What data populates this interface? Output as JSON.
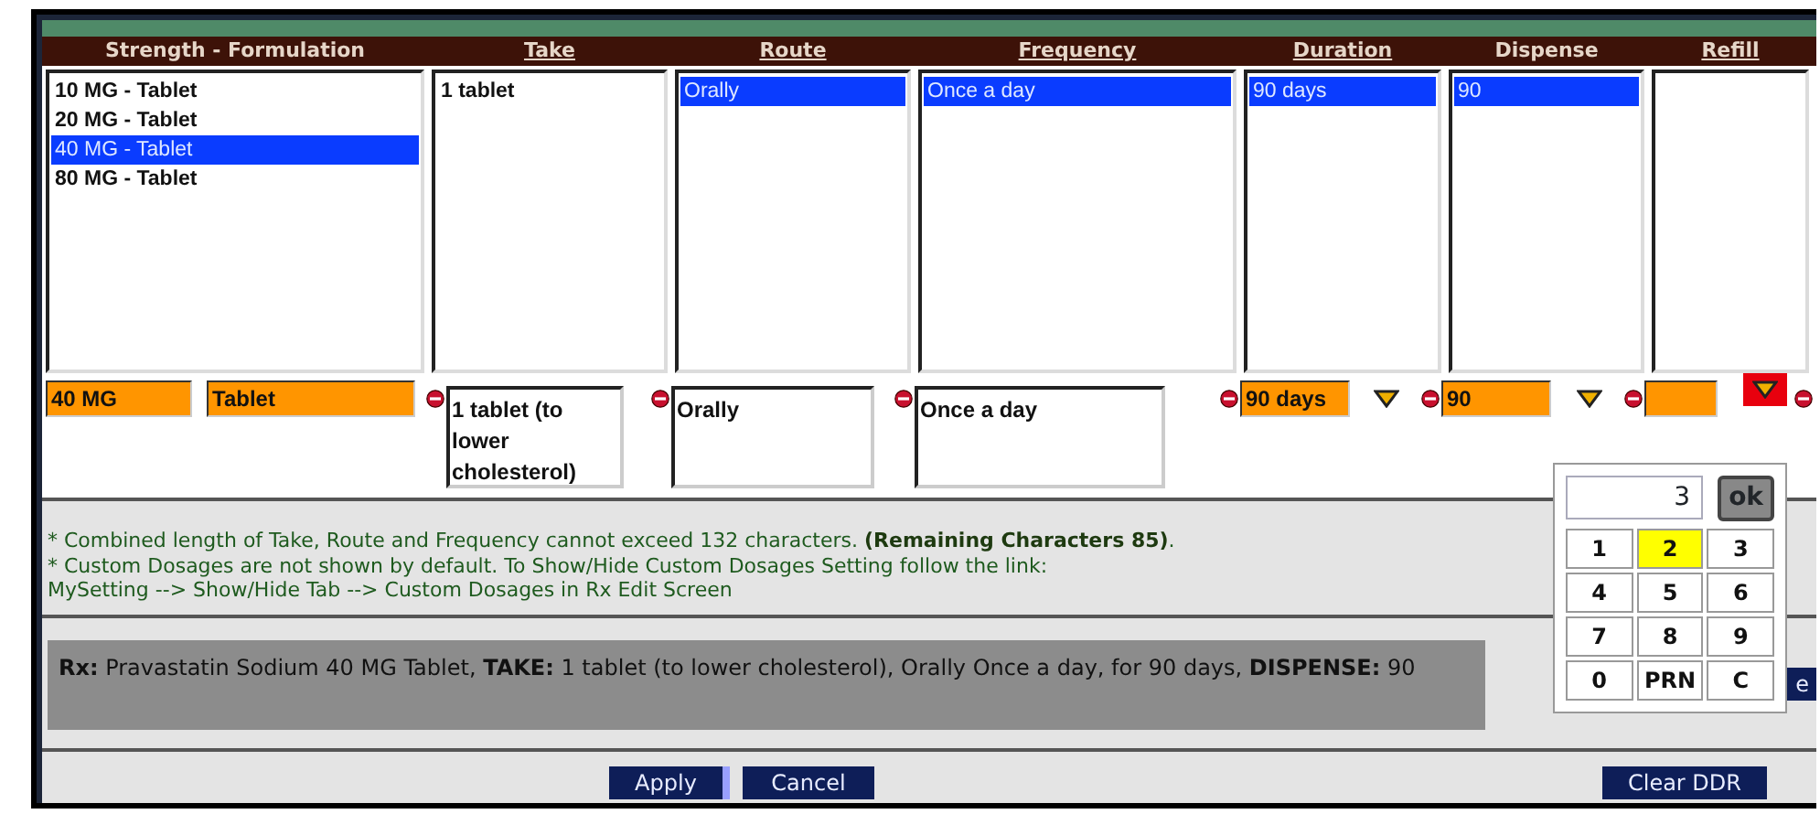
{
  "columns": [
    {
      "label": "Strength - Formulation",
      "underlined": false,
      "items": [
        {
          "text": "10 MG - Tablet",
          "selected": false
        },
        {
          "text": "20 MG - Tablet",
          "selected": false
        },
        {
          "text": "40 MG - Tablet",
          "selected": true
        },
        {
          "text": "80 MG - Tablet",
          "selected": false
        }
      ]
    },
    {
      "label": "Take",
      "underlined": true,
      "items": [
        {
          "text": "1 tablet",
          "selected": false
        }
      ]
    },
    {
      "label": "Route",
      "underlined": true,
      "items": [
        {
          "text": "Orally",
          "selected": true
        }
      ]
    },
    {
      "label": "Frequency",
      "underlined": true,
      "items": [
        {
          "text": "Once a day",
          "selected": true
        }
      ]
    },
    {
      "label": "Duration",
      "underlined": true,
      "items": [
        {
          "text": "90 days",
          "selected": true
        }
      ]
    },
    {
      "label": "Dispense",
      "underlined": false,
      "items": [
        {
          "text": "90",
          "selected": true
        }
      ]
    },
    {
      "label": "Refill",
      "underlined": true
    }
  ],
  "edit_row": [
    {
      "fields": [
        {
          "kind": "orange",
          "value": "40 MG"
        },
        {
          "kind": "orange",
          "value": "Tablet"
        }
      ]
    },
    {
      "fields": [
        {
          "kind": "textarea",
          "value": "1 tablet (to lower cholesterol)"
        }
      ],
      "remove": true
    },
    {
      "fields": [
        {
          "kind": "textarea",
          "value": "Orally"
        }
      ],
      "remove": true
    },
    {
      "fields": [
        {
          "kind": "textarea",
          "value": "Once a day"
        }
      ],
      "remove": true
    },
    {
      "fields": [
        {
          "kind": "orange",
          "value": "90 days"
        }
      ],
      "dropdown": true,
      "highlighted": false,
      "remove": true
    },
    {
      "fields": [
        {
          "kind": "orange",
          "value": "90"
        }
      ],
      "dropdown": true,
      "highlighted": false,
      "remove": true
    },
    {
      "fields": [
        {
          "kind": "orange"
        }
      ],
      "dropdown": true,
      "highlighted": true,
      "remove": true,
      "trailing_remove": true
    }
  ],
  "notes": [
    "* Combined length of Take, Route and Frequency cannot exceed 132 characters.  **(Remaining Characters 85)**.",
    "* Custom Dosages are not shown by default. To Show/Hide Custom Dosages Setting follow the link:",
    "MySetting --> Show/Hide Tab --> Custom Dosages in Rx Edit Screen"
  ],
  "summary": "**Rx:** Pravastatin Sodium 40 MG Tablet, **TAKE:** 1 tablet (to lower cholesterol), Orally Once a day, for 90 days, **DISPENSE:** 90",
  "hidden_button": "e",
  "keypad": {
    "display": "3",
    "ok": "ok",
    "keys": [
      {
        "label": "1",
        "selected": false
      },
      {
        "label": "2",
        "selected": true
      },
      {
        "label": "3",
        "selected": false
      },
      {
        "label": "4",
        "selected": false
      },
      {
        "label": "5",
        "selected": false
      },
      {
        "label": "6",
        "selected": false
      },
      {
        "label": "7",
        "selected": false
      },
      {
        "label": "8",
        "selected": false
      },
      {
        "label": "9",
        "selected": false
      },
      {
        "label": "0",
        "selected": false
      },
      {
        "label": "PRN",
        "selected": false
      },
      {
        "label": "C",
        "selected": false
      }
    ]
  },
  "buttons": [
    "Apply",
    "Cancel"
  ],
  "right_button": "Clear DDR"
}
